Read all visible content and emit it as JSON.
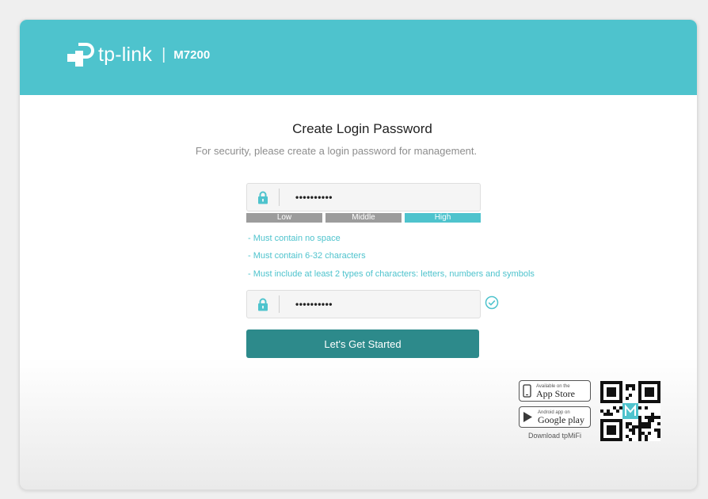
{
  "header": {
    "brand": "tp-link",
    "separator": "|",
    "model": "M7200",
    "background_color": "#4ec3cd"
  },
  "main": {
    "title": "Create Login Password",
    "subtitle": "For security, please create a login password for management.",
    "password": {
      "icon": "lock-icon",
      "masked_value": "••••••••••",
      "strength_levels": [
        "Low",
        "Middle",
        "High"
      ],
      "active_strength": "High"
    },
    "rules": [
      "- Must contain no space",
      "- Must contain 6-32 characters",
      "- Must include at least 2 types of characters: letters, numbers and symbols"
    ],
    "confirm_password": {
      "icon": "lock-icon",
      "masked_value": "••••••••••",
      "match_icon": "check-circle-icon"
    },
    "start_button_label": "Let's Get Started",
    "accent_color": "#4ec3cd",
    "button_color": "#2d8a8b"
  },
  "footer": {
    "app_store": {
      "small": "Available on the",
      "big": "App Store",
      "icon": "phone-icon"
    },
    "google_play": {
      "small": "Android app on",
      "big": "Google play",
      "icon": "play-icon"
    },
    "download_text": "Download tpMiFi",
    "qr_icon": "qr-code-icon"
  }
}
